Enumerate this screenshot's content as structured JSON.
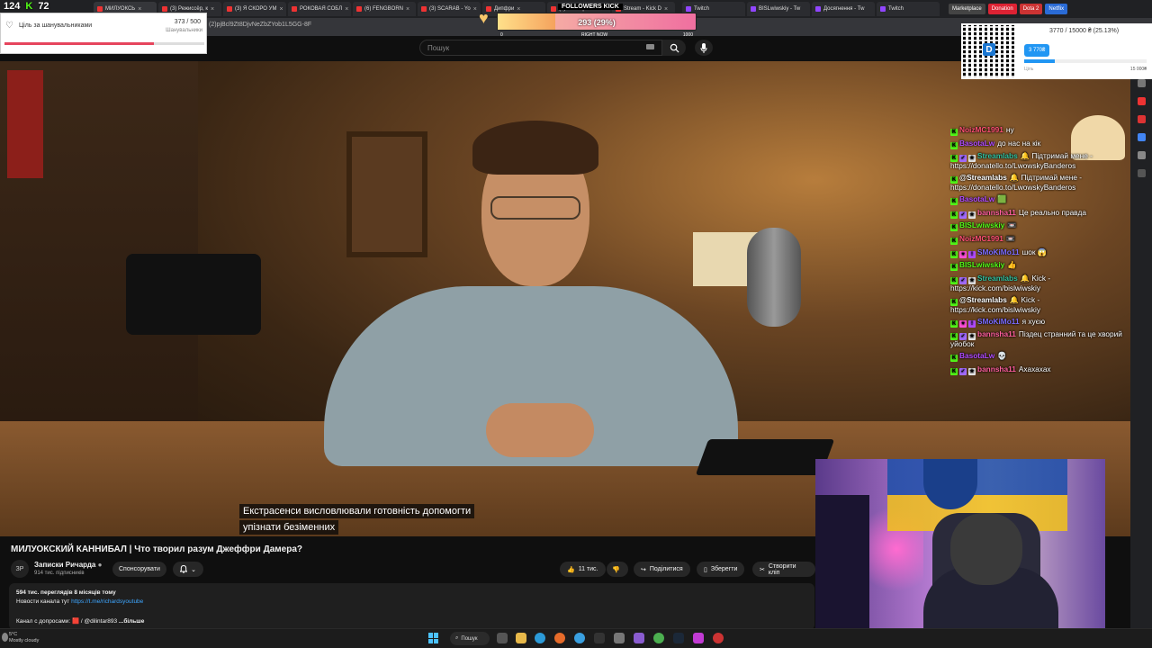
{
  "overlays": {
    "counter_a": "124",
    "counter_b": "72",
    "goal_widget": {
      "label": "Ціль за шанувальниками",
      "current": "373 / 500",
      "sub": "Шанувальники",
      "progress": 0.746
    },
    "followers": {
      "title": "FOLLOWERS KICK",
      "value": "293 (29%)",
      "progress": 0.293,
      "min": "0",
      "mid": "RIGHT NOW",
      "max": "1000"
    },
    "donation": {
      "amount": "3770 / 15000 ₴ (25.13%)",
      "tag": "3 770₴",
      "label": "Ціль",
      "goal": "15 000₴",
      "progress": 0.2513
    }
  },
  "browser": {
    "tabs": [
      {
        "label": "МИЛУОКСЬ"
      },
      {
        "label": "(3) Режиссёр, к"
      },
      {
        "label": "(3) Я СКОРО УМ"
      },
      {
        "label": "РОКОВАЯ СОБЛ"
      },
      {
        "label": "(6) FENGBORN"
      },
      {
        "label": "(3) SCARAB - Yo"
      },
      {
        "label": "Дипфри"
      },
      {
        "label": "(2) Мистерия о"
      },
      {
        "label": "Stream - Kick D"
      }
    ],
    "bookmarks": [
      "Twitch",
      "BISLwiwskiy - Tw",
      "Досягнення - Tw",
      "Twitch"
    ],
    "extension_buttons": [
      "Marketplace",
      "Donation",
      "Dota 2",
      "Netflix"
    ],
    "url_fragment": "(2)pjBcl9Zt8DjvNeZbZYob1L5GG-8F"
  },
  "youtube": {
    "search_placeholder": "Пошук",
    "subtitle_line1": "Екстрасенси висловлювали готовність допомогти",
    "subtitle_line2": "упізнати безіменних",
    "video_title": "МИЛУОКСКИЙ КАННИБАЛ | Что творил разум Джеффри Дамера?",
    "channel_name": "Записки Ричарда",
    "channel_subs": "914 тис. підписників",
    "sponsor_label": "Спонсорувати",
    "likes": "11 тис.",
    "share_label": "Поділитися",
    "save_label": "Зберегти",
    "clip_label": "Створити кліп",
    "views": "594 тис. переглядів  8 місяців тому",
    "desc_line": "Новости канала тут",
    "desc_link": "https://t.me/richardsyoutube",
    "desc_line3": "Канал с допросами: 🟥 / @dilintar893",
    "more_label": "...більше"
  },
  "chat": [
    {
      "user": "NoizMC1991",
      "color": "#ff4f73",
      "badges": [
        "k"
      ],
      "text": "ну"
    },
    {
      "user": "BasotaLw",
      "color": "#b04bff",
      "badges": [
        "k"
      ],
      "text": "до нас на кік"
    },
    {
      "user": "Streamlabs",
      "color": "#31c3a2",
      "badges": [
        "k",
        "s",
        "c"
      ],
      "text": "🔔 Підтримай мене - https://donatello.to/LwowskyBanderos"
    },
    {
      "user": "@Streamlabs",
      "color": "#ffffff",
      "badges": [
        "k"
      ],
      "text": "🔔 Підтримай мене - https://donatello.to/LwowskyBanderos"
    },
    {
      "user": "BasotaLw",
      "color": "#b04bff",
      "badges": [
        "k"
      ],
      "text": "🟩"
    },
    {
      "user": "bannsha11",
      "color": "#ff5f9e",
      "badges": [
        "k",
        "s",
        "c"
      ],
      "text": "Це реально правда"
    },
    {
      "user": "BISLwiwskiy",
      "color": "#53fc18",
      "badges": [
        "k"
      ],
      "text": "📼"
    },
    {
      "user": "NoizMC1991",
      "color": "#ff4f73",
      "badges": [
        "k"
      ],
      "text": "📼"
    },
    {
      "user": "SMoKiMo11",
      "color": "#7b6cff",
      "badges": [
        "k",
        "h",
        "v"
      ],
      "text": "шок 😱"
    },
    {
      "user": "BISLwiwskiy",
      "color": "#53fc18",
      "badges": [
        "k"
      ],
      "text": "👍"
    },
    {
      "user": "Streamlabs",
      "color": "#31c3a2",
      "badges": [
        "k",
        "s",
        "c"
      ],
      "text": "🔔 Kick - https://kick.com/bislwiwskiy"
    },
    {
      "user": "@Streamlabs",
      "color": "#ffffff",
      "badges": [
        "k"
      ],
      "text": "🔔 Kick - https://kick.com/bislwiwskiy"
    },
    {
      "user": "SMoKiMo11",
      "color": "#7b6cff",
      "badges": [
        "k",
        "h",
        "v"
      ],
      "text": "я хуєю"
    },
    {
      "user": "bannsha11",
      "color": "#ff5f9e",
      "badges": [
        "k",
        "s",
        "c"
      ],
      "text": "Піздец странний та це хворий уйобок"
    },
    {
      "user": "BasotaLw",
      "color": "#b04bff",
      "badges": [
        "k"
      ],
      "text": "💀"
    },
    {
      "user": "bannsha11",
      "color": "#ff5f9e",
      "badges": [
        "k",
        "s",
        "c"
      ],
      "text": "Ахахахах"
    }
  ],
  "taskbar": {
    "weather_temp": "5°C",
    "weather_desc": "Mostly cloudy",
    "search_label": "Пошук"
  },
  "colors": {
    "kick_green": "#53fc18",
    "youtube_bg": "#0f0f0f",
    "goal_red": "#e6455d",
    "donation_blue": "#2196f3"
  }
}
